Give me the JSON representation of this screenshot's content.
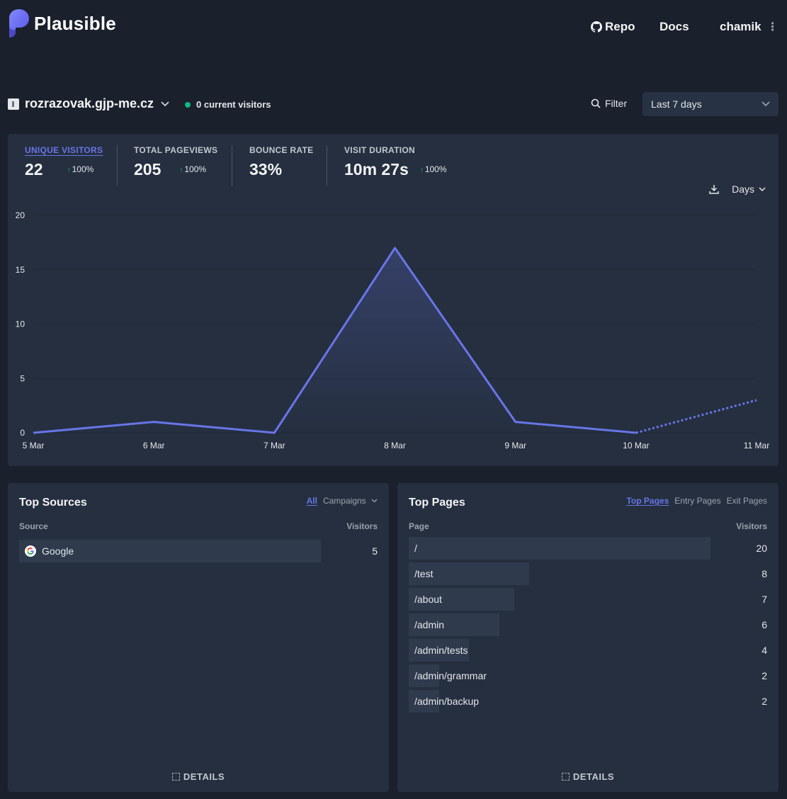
{
  "header": {
    "brand": "Plausible",
    "nav": {
      "repo": "Repo",
      "docs": "Docs",
      "user": "chamik"
    }
  },
  "site": {
    "domain": "rozrazovak.gjp-me.cz",
    "live": "0 current visitors",
    "filter_label": "Filter",
    "period": "Last 7 days"
  },
  "stats": [
    {
      "label": "UNIQUE VISITORS",
      "value": "22",
      "change": "100%"
    },
    {
      "label": "TOTAL PAGEVIEWS",
      "value": "205",
      "change": "100%"
    },
    {
      "label": "BOUNCE RATE",
      "value": "33%",
      "change": ""
    },
    {
      "label": "VISIT DURATION",
      "value": "10m 27s",
      "change": "100%"
    }
  ],
  "chart_tools": {
    "interval": "Days"
  },
  "chart_data": {
    "type": "line",
    "x": [
      "5 Mar",
      "6 Mar",
      "7 Mar",
      "8 Mar",
      "9 Mar",
      "10 Mar",
      "11 Mar"
    ],
    "series": [
      {
        "values": [
          0,
          1,
          0,
          17,
          1,
          0,
          3
        ]
      }
    ],
    "ylim": [
      0,
      20
    ],
    "yticks": [
      "0",
      "5",
      "10",
      "15",
      "20"
    ],
    "grid": true,
    "colors": {
      "line": "#6875e8"
    }
  },
  "top_sources": {
    "title": "Top Sources",
    "tabs": {
      "all": "All",
      "campaigns": "Campaigns"
    },
    "col_source": "Source",
    "col_visitors": "Visitors",
    "rows": [
      {
        "label": "Google",
        "value": "5",
        "icon": "google-icon"
      }
    ],
    "details": "DETAILS"
  },
  "top_pages": {
    "title": "Top Pages",
    "tabs": {
      "top": "Top Pages",
      "entry": "Entry Pages",
      "exit": "Exit Pages"
    },
    "col_page": "Page",
    "col_visitors": "Visitors",
    "rows": [
      {
        "label": "/",
        "value": "20"
      },
      {
        "label": "/test",
        "value": "8"
      },
      {
        "label": "/about",
        "value": "7"
      },
      {
        "label": "/admin",
        "value": "6"
      },
      {
        "label": "/admin/tests",
        "value": "4"
      },
      {
        "label": "/admin/grammar",
        "value": "2"
      },
      {
        "label": "/admin/backup",
        "value": "2"
      }
    ],
    "details": "DETAILS"
  }
}
